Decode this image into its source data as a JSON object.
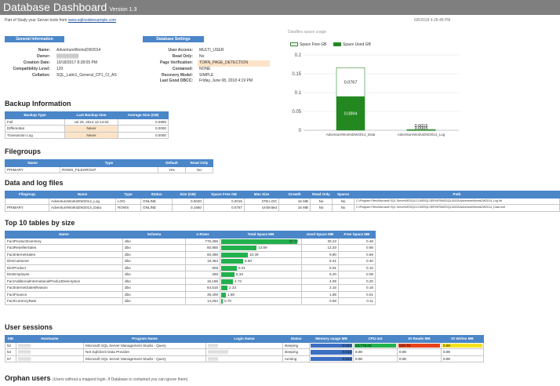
{
  "header": {
    "title": "Database Dashboard",
    "version": "Version 1.3",
    "subtitle_text": "Part of Study your Server tools from ",
    "subtitle_link": "www.sqlinsideexample.com",
    "timestamp": "6/8/2018 4:28:48 PM"
  },
  "general": {
    "title": "General Information",
    "rows": [
      {
        "k": "Name:",
        "v": "AdventureWorksDW2014"
      },
      {
        "k": "Owner:",
        "v": "▒▒▒▒▒▒▒▒"
      },
      {
        "k": "Creation Date:",
        "v": "10/18/2017 8:28:05 PM"
      },
      {
        "k": "Compatibility Level:",
        "v": "120"
      },
      {
        "k": "Collation:",
        "v": "SQL_Latin1_General_CP1_CI_AS"
      }
    ]
  },
  "settings": {
    "title": "Database Settings",
    "rows": [
      {
        "k": "User Access:",
        "v": "MULTI_USER",
        "hl": false
      },
      {
        "k": "Read Only:",
        "v": "No",
        "hl": false
      },
      {
        "k": "Page Verification:",
        "v": "TORN_PAGE_DETECTION",
        "hl": true
      },
      {
        "k": "Contained:",
        "v": "NONE",
        "hl": false
      },
      {
        "k": "Recovery Model:",
        "v": "SIMPLE",
        "hl": false
      },
      {
        "k": "Last Good DBCC:",
        "v": "Friday, June 08, 2018 4:19 PM",
        "hl": false
      }
    ]
  },
  "chart_data": {
    "type": "bar",
    "title": "Datafiles space usage",
    "categories": [
      "AdventureWorksDW2014_Data",
      "AdventureWorksDW2014_Log"
    ],
    "series": [
      {
        "name": "Space Free GB",
        "color": "#ffffff",
        "values": [
          0.0767,
          0.0015
        ]
      },
      {
        "name": "Space Used GB",
        "color": "#22881f",
        "values": [
          0.0894,
          0.0005
        ]
      }
    ],
    "value_labels": [
      [
        "0.0767",
        "0.0894"
      ],
      [
        "0.0015",
        "0.0005"
      ]
    ],
    "ylim": [
      0,
      0.2
    ],
    "yticks": [
      "0",
      "0.05",
      "0.1",
      "0.15",
      "0.2"
    ],
    "legend": "top",
    "grid": true
  },
  "backup": {
    "title": "Backup Information",
    "cols": [
      "Backup Type",
      "Last Backup time",
      "Average Size (GB)"
    ],
    "rows": [
      [
        "Full",
        "Jul 25, 2014 12:14:04",
        "0.0899",
        false
      ],
      [
        "Differential",
        "Never",
        "0.0000",
        true
      ],
      [
        "Transaction Log",
        "Never",
        "0.0000",
        true
      ]
    ]
  },
  "filegroups": {
    "title": "Filegroups",
    "cols": [
      "Name",
      "Type",
      "Default",
      "Read Only"
    ],
    "rows": [
      [
        "PRIMARY",
        "ROWS_FILEGROUP",
        "Yes",
        "No"
      ]
    ]
  },
  "files": {
    "title": "Data and log files",
    "cols": [
      "Filegroup",
      "Name",
      "Type",
      "Status",
      "Size (GB)",
      "Space Free GB",
      "Max Size",
      "Growth",
      "Read Only",
      "Sparse",
      "Path"
    ],
    "rows": [
      [
        "",
        "AdventureWorksDW2014_Log",
        "LOG",
        "ONLINE",
        "0.0020",
        "0.0015",
        "2TB LOG",
        "16 MB",
        "No",
        "No",
        "C:\\Program Files\\Microsoft SQL Server\\MSSQL13.MSSQLSERVER\\MSSQL\\DATA\\AdventureWorksDW2014_Log.ldf"
      ],
      [
        "PRIMARY",
        "AdventureWorksDW2014_Data",
        "ROWS",
        "ONLINE",
        "0.1660",
        "0.0767",
        "Unlimited",
        "16 MB",
        "No",
        "No",
        "C:\\Program Files\\Microsoft SQL Server\\MSSQL13.MSSQLSERVER\\MSSQL\\DATA\\AdventureWorksDW2014_Data.mdf"
      ]
    ]
  },
  "toptables": {
    "title": "Top 10 tables by size",
    "cols": [
      "Name",
      "Schema",
      "n Rows",
      "Total Space MB",
      "Used Space MB",
      "Free Space MB"
    ],
    "rows": [
      {
        "name": "FactProductInventory",
        "schema": "dbo",
        "rows": "776,286",
        "total": "30.70",
        "total_pct": 0.97,
        "used": "30.22",
        "free": "0.48"
      },
      {
        "name": "FactResellerSales",
        "schema": "dbo",
        "rows": "60,855",
        "total": "13.89",
        "total_pct": 0.45,
        "used": "12.20",
        "free": "0.69"
      },
      {
        "name": "FactInternetSales",
        "schema": "dbo",
        "rows": "60,398",
        "total": "10.39",
        "total_pct": 0.34,
        "used": "9.80",
        "free": "0.59"
      },
      {
        "name": "DimCustomer",
        "schema": "dbo",
        "rows": "18,484",
        "total": "8.80",
        "total_pct": 0.28,
        "used": "8.41",
        "free": "0.40"
      },
      {
        "name": "DimProduct",
        "schema": "dbo",
        "rows": "606",
        "total": "6.01",
        "total_pct": 0.2,
        "used": "5.91",
        "free": "0.10"
      },
      {
        "name": "DimEmployee",
        "schema": "dbo",
        "rows": "296",
        "total": "5.33",
        "total_pct": 0.17,
        "used": "5.20",
        "free": "0.08"
      },
      {
        "name": "FactAdditionalInternationalProductDescription",
        "schema": "dbo",
        "rows": "15,168",
        "total": "4.73",
        "total_pct": 0.15,
        "used": "4.09",
        "free": "0.20"
      },
      {
        "name": "FactInternetSalesReason",
        "schema": "dbo",
        "rows": "64,515",
        "total": "2.33",
        "total_pct": 0.08,
        "used": "2.16",
        "free": "0.16"
      },
      {
        "name": "FactFinance",
        "schema": "dbo",
        "rows": "39,409",
        "total": "1.88",
        "total_pct": 0.06,
        "used": "1.88",
        "free": "0.01"
      },
      {
        "name": "FactCurrencyRate",
        "schema": "dbo",
        "rows": "14,264",
        "total": "0.70",
        "total_pct": 0.02,
        "used": "0.59",
        "free": "0.11"
      }
    ]
  },
  "sessions": {
    "title": "User sessions",
    "cols": [
      "SID",
      "Hostname",
      "Program Name",
      "Login Name",
      "Status",
      "Memory usage MB",
      "CPU mS",
      "IO Reads MB",
      "IO Writes MB"
    ],
    "rows": [
      {
        "sid": "52",
        "host": "▒▒▒▒▒",
        "prog": "Microsoft SQL Server Management Studio - Query",
        "login": "▒▒▒▒",
        "status": "sleeping",
        "mem": "0.023",
        "cpu": "13,776.00",
        "io_r": "229.79",
        "io_w": "0.59",
        "hm": [
          "#3c6fc2",
          "#22b14c",
          "#e8421a",
          "#f5e21c"
        ]
      },
      {
        "sid": "54",
        "host": "▒▒▒▒▒",
        "prog": "Net SqlClient Data Provider",
        "login": "▒▒▒▒▒▒▒▒",
        "status": "sleeping",
        "mem": "0.016",
        "cpu": "0.00",
        "io_r": "0.00",
        "io_w": "0.00",
        "hm": [
          "#3c6fc2",
          "",
          "",
          ""
        ]
      },
      {
        "sid": "57",
        "host": "▒▒▒▒▒",
        "prog": "Microsoft SQL Server Management Studio - Query",
        "login": "▒▒▒▒",
        "status": "running",
        "mem": "0.023",
        "cpu": "0.00",
        "io_r": "0.00",
        "io_w": "0.00",
        "hm": [
          "#3c6fc2",
          "",
          "",
          ""
        ]
      }
    ]
  },
  "orphans": {
    "title": "Orphan users",
    "note": "(Users without a mapped login. If Database is contained you can ignore them)"
  }
}
